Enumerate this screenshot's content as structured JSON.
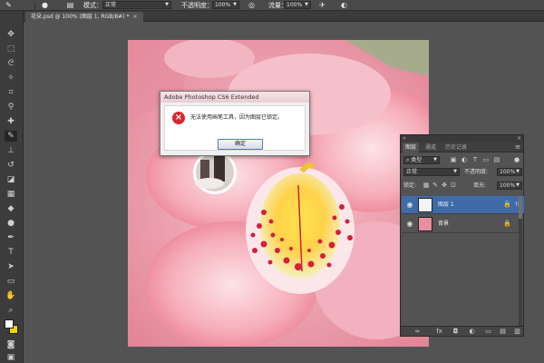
{
  "options_bar": {
    "mode_label": "模式：",
    "mode_value": "正常",
    "opacity_label": "不透明度：",
    "opacity_value": "100%",
    "flow_label": "流量：",
    "flow_value": "100%"
  },
  "document": {
    "tab_title": "花朵.psd @ 100% (图层 1, RGB/8#) *",
    "close_glyph": "×"
  },
  "dialog": {
    "title": "Adobe Photoshop CS6 Extended",
    "message": "无法使用画笔工具，因为图层已锁定。",
    "ok_label": "确定",
    "error_glyph": "×"
  },
  "layers_panel": {
    "tabs": [
      "图层",
      "通道",
      "历史记录"
    ],
    "filter_label": "类型",
    "blend_mode": "正常",
    "opacity_label": "不透明度:",
    "opacity_value": "100%",
    "lock_label": "锁定:",
    "fill_label": "填充:",
    "fill_value": "100%",
    "layers": [
      {
        "name": "图层 1",
        "selected": true
      },
      {
        "name": "背景",
        "selected": false
      }
    ]
  },
  "colors": {
    "foreground": "#ffffff",
    "background": "#e8d400",
    "selection": "#3f6ba9",
    "error_red": "#d7262e"
  }
}
